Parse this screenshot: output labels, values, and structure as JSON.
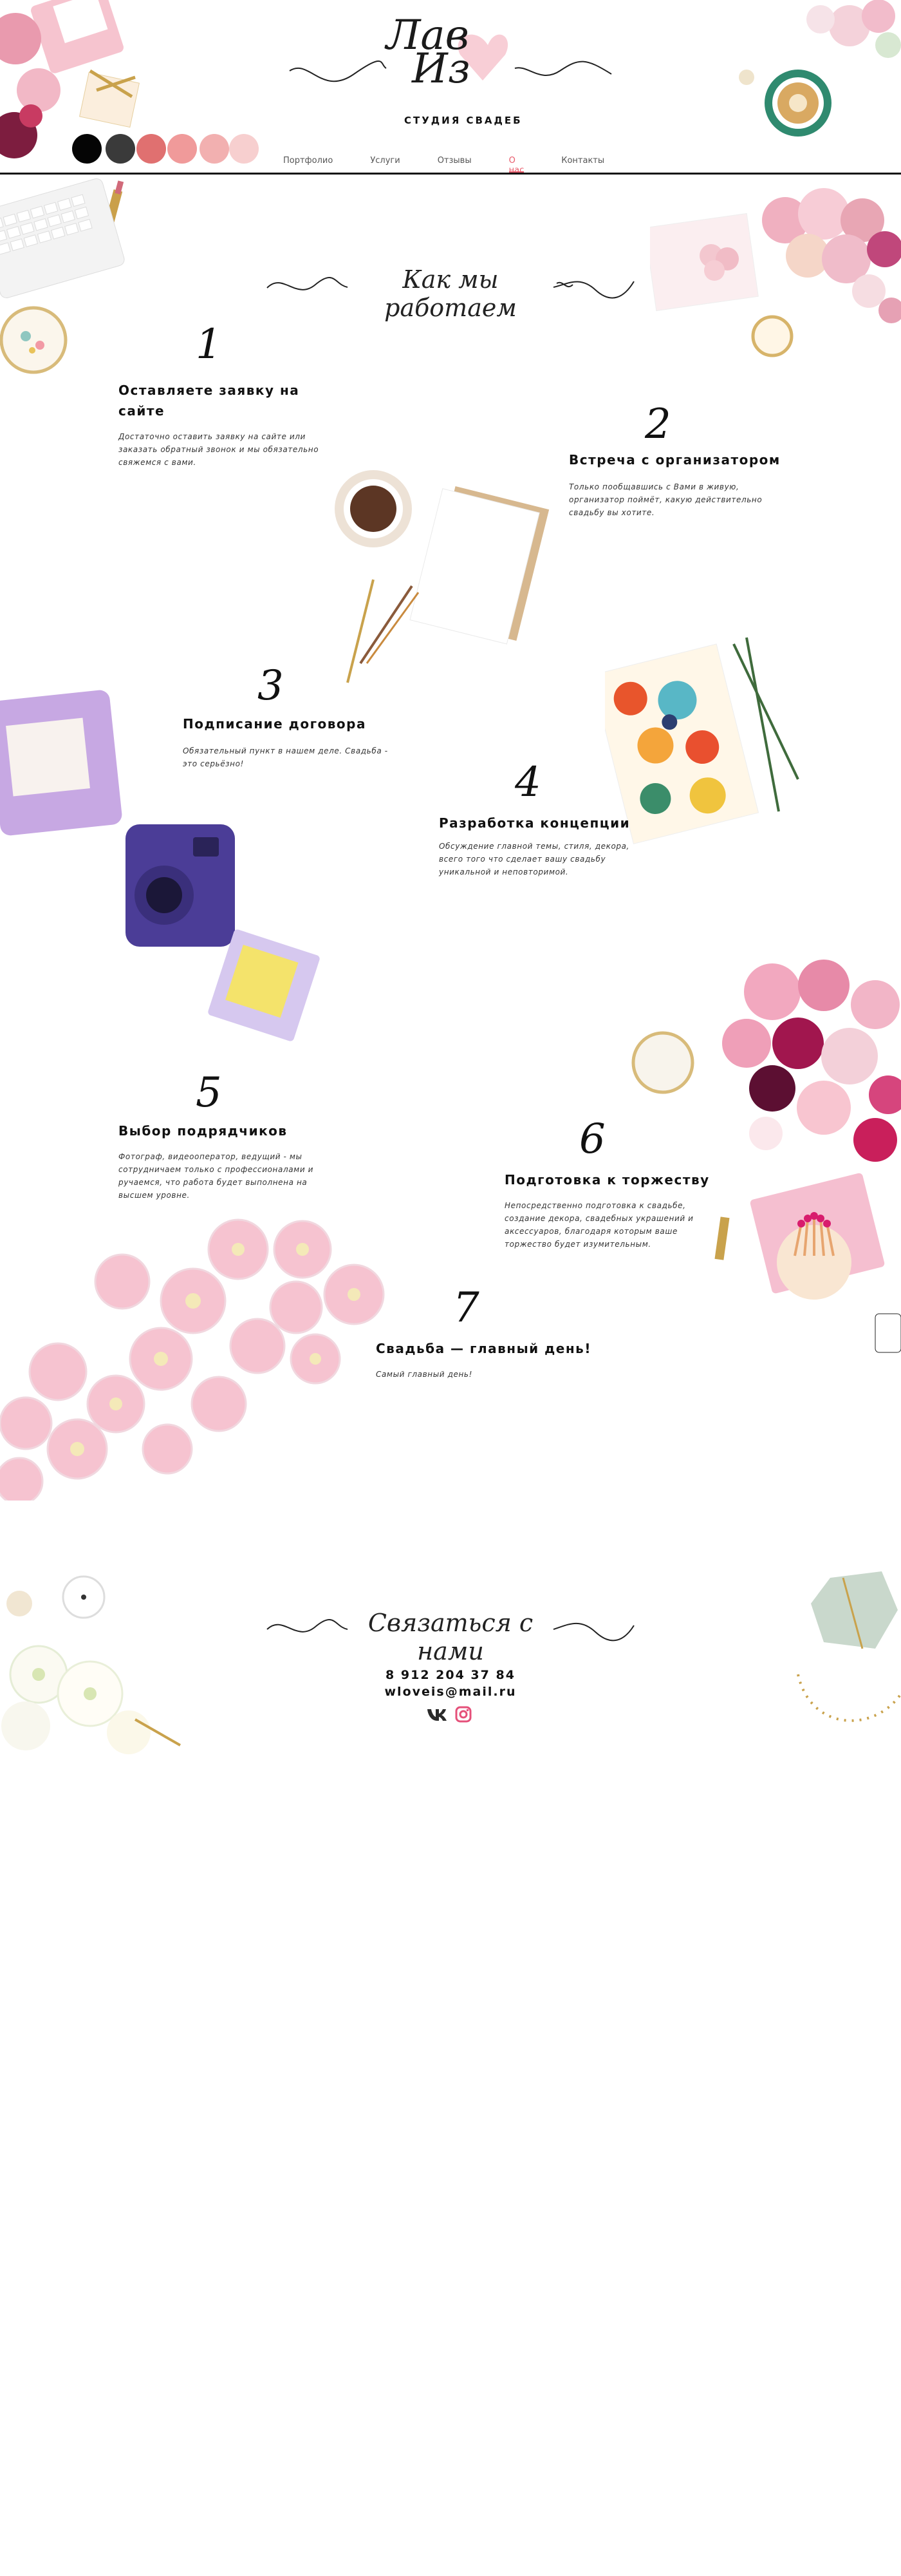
{
  "logo": {
    "line1": "Лав",
    "line2": "Из",
    "subtitle": "СТУДИЯ СВАДЕБ"
  },
  "palette": [
    "#050505",
    "#3a3a3a",
    "#e07070",
    "#f09a9a",
    "#f2b0b0",
    "#f7cfcf"
  ],
  "nav": {
    "items": [
      {
        "label": "Портфолио",
        "active": false
      },
      {
        "label": "Услуги",
        "active": false
      },
      {
        "label": "Отзывы",
        "active": false
      },
      {
        "label": "О нас",
        "active": true
      },
      {
        "label": "Контакты",
        "active": false
      }
    ],
    "accent": "#e85b6b"
  },
  "how": {
    "title": "Как мы работаем",
    "steps": [
      {
        "num": "1",
        "title": "Оставляете заявку на сайте",
        "text": "Достаточно оставить заявку на сайте или заказать обратный звонок и мы обязательно свяжемся с вами."
      },
      {
        "num": "2",
        "title": "Встреча с организатором",
        "text": "Только пообщавшись с Вами в живую, организатор поймёт, какую действительно свадьбу вы хотите."
      },
      {
        "num": "3",
        "title": "Подписание договора",
        "text": "Обязательный пункт в нашем деле. Свадьба - это серьёзно!"
      },
      {
        "num": "4",
        "title": "Разработка концепции",
        "text": "Обсуждение главной темы, стиля, декора, всего того что сделает вашу свадьбу уникальной и неповторимой."
      },
      {
        "num": "5",
        "title": "Выбор подрядчиков",
        "text": "Фотограф, видеооператор, ведущий - мы сотрудничаем только с профессионалами и ручаемся, что работа будет выполнена на высшем уровне."
      },
      {
        "num": "6",
        "title": "Подготовка к торжеству",
        "text": "Непосредственно подготовка к свадьбе, создание декора, свадебных украшений и аксессуаров, благодаря которым ваше торжество будет изумительным."
      },
      {
        "num": "7",
        "title": "Свадьба — главный день!",
        "text": "Самый главный день!"
      }
    ]
  },
  "contact": {
    "title": "Связаться с нами",
    "phone": "8 912 204 37 84",
    "email": "wloveis@mail.ru",
    "socials": [
      "vk-icon",
      "instagram-icon"
    ]
  }
}
